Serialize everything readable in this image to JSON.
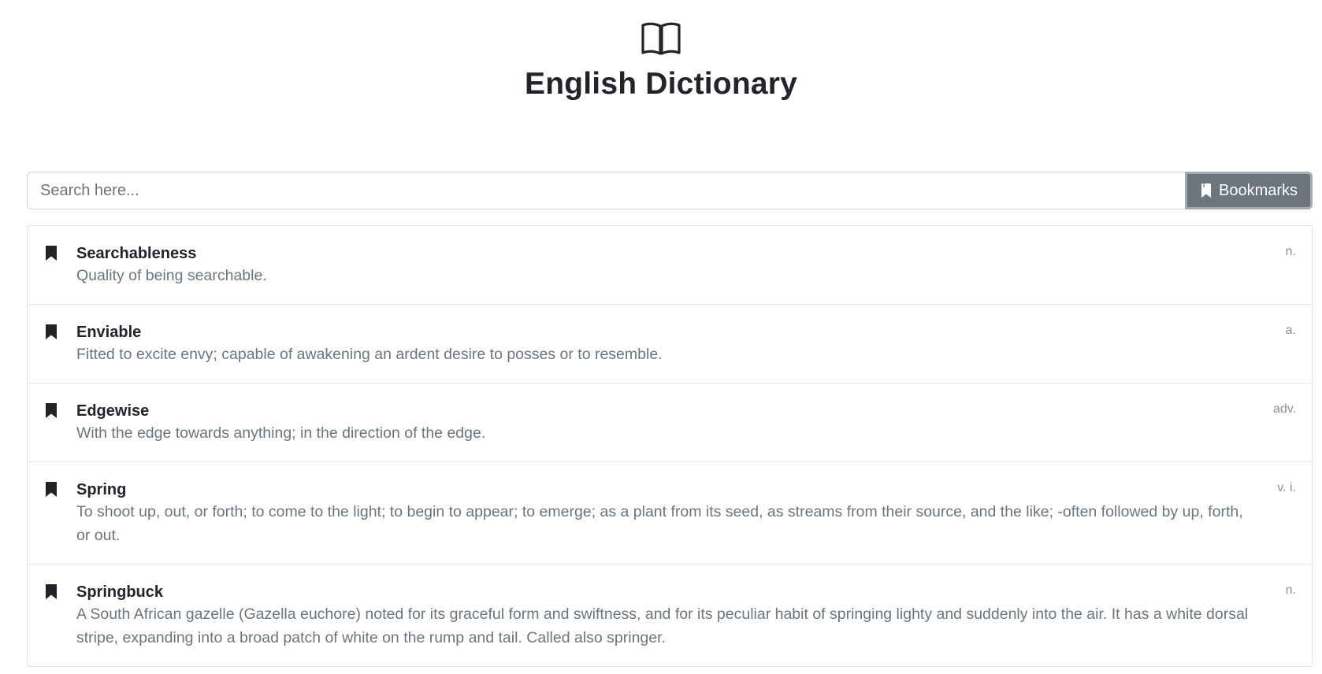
{
  "header": {
    "logo_icon": "open-book-icon",
    "title": "English Dictionary"
  },
  "search": {
    "placeholder": "Search here...",
    "value": "",
    "bookmarks_label": "Bookmarks",
    "bookmarks_icon": "bookmark-icon"
  },
  "entries": [
    {
      "word": "Searchableness",
      "pos": "n.",
      "definition": "Quality of being searchable."
    },
    {
      "word": "Enviable",
      "pos": "a.",
      "definition": "Fitted to excite envy; capable of awakening an ardent desire to posses or to resemble."
    },
    {
      "word": "Edgewise",
      "pos": "adv.",
      "definition": "With the edge towards anything; in the direction of the edge."
    },
    {
      "word": "Spring",
      "pos": "v. i.",
      "definition": "To shoot up, out, or forth; to come to the light; to begin to appear; to emerge; as a plant from its seed, as streams from their source, and the like; -often followed by up, forth, or out."
    },
    {
      "word": "Springbuck",
      "pos": "n.",
      "definition": "A South African gazelle (Gazella euchore) noted for its graceful form and swiftness, and for its peculiar habit of springing lighty and suddenly into the air. It has a white dorsal stripe, expanding into a broad patch of white on the rump and tail. Called also springer."
    }
  ],
  "colors": {
    "button_bg": "#6c757d",
    "text_dark": "#212529",
    "text_muted": "#6c757d",
    "border": "#dee2e6"
  }
}
